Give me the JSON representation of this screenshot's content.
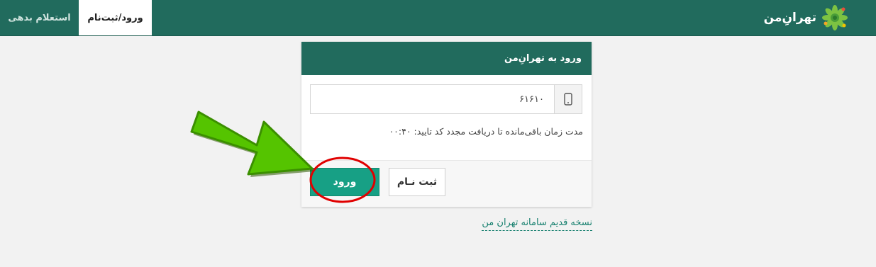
{
  "header": {
    "brand": "تهرانِ‌من",
    "tabs": [
      {
        "label": "ورود/ثبت‌نام",
        "active": true
      },
      {
        "label": "استعلام بدهی",
        "active": false
      }
    ]
  },
  "login_card": {
    "title": "ورود به تهرانِ‌من",
    "phone_value": "۶۱۶۱۰",
    "timer_text": "مدت زمان باقی‌مانده تا دریافت مجدد کد تایید: ۰۰:۴۰",
    "register_label": "ثبت نـام",
    "login_label": "ورود"
  },
  "old_version_link": "نسخه قدیم سامانه تهران من",
  "colors": {
    "header": "#216b5d",
    "login_button": "#17a085",
    "annotation_arrow": "#55c400",
    "annotation_circle": "#e00000"
  },
  "icons": {
    "logo": "tehran-flower-logo-icon",
    "phone": "mobile-phone-icon",
    "annotation": "green-arrow-pointer-icon"
  }
}
